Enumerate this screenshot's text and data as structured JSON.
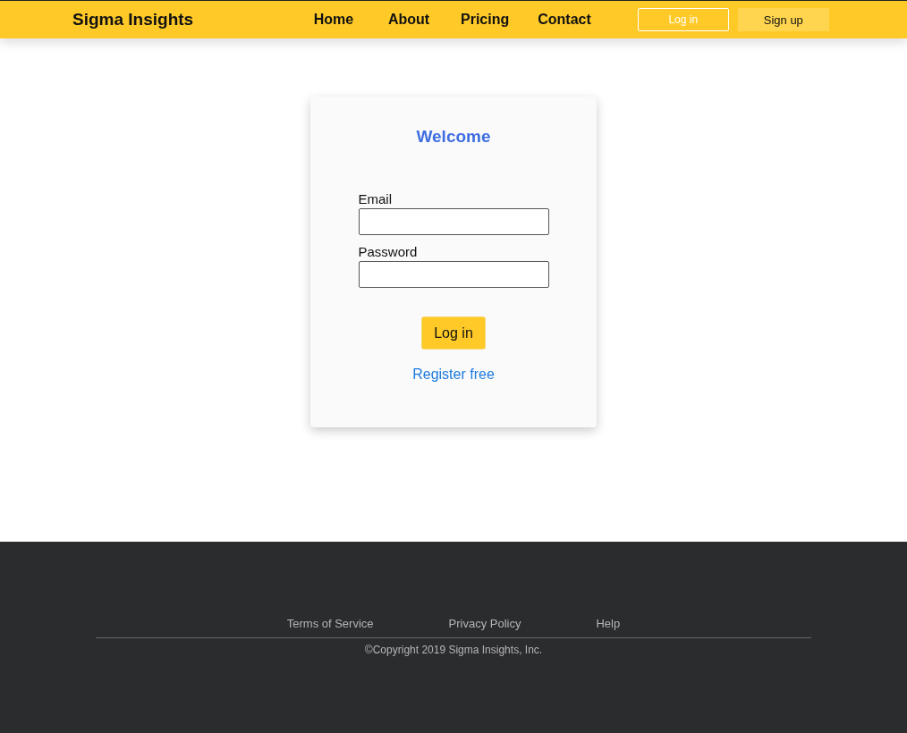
{
  "header": {
    "brand": "Sigma Insights",
    "nav": [
      "Home",
      "About",
      "Pricing",
      "Contact"
    ],
    "login_button": "Log in",
    "signup_button": "Sign up"
  },
  "login_card": {
    "title": "Welcome",
    "fields": [
      {
        "label": "Email"
      },
      {
        "label": "Password"
      }
    ],
    "submit_button": "Log in",
    "register_link": "Register free"
  },
  "footer": {
    "links": [
      "Terms of Service",
      "Privacy Policy",
      "Help"
    ],
    "copyright": "©Copyright 2019 Sigma Insights, Inc."
  }
}
